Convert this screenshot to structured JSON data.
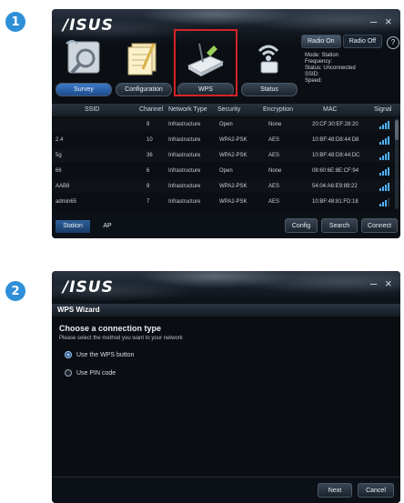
{
  "steps": [
    "1",
    "2"
  ],
  "window1": {
    "logo": "/ISUS",
    "controls": {
      "minimize": "–",
      "close": "×"
    },
    "nav": [
      {
        "label": "Survey",
        "icon": "survey-icon",
        "active": true
      },
      {
        "label": "Configuration",
        "icon": "configuration-icon",
        "active": false
      },
      {
        "label": "WPS",
        "icon": "wps-router-icon",
        "active": false
      },
      {
        "label": "Status",
        "icon": "status-signal-icon",
        "active": false
      }
    ],
    "radio": {
      "on_label": "Radio On",
      "off_label": "Radio Off"
    },
    "help": "?",
    "status_lines": [
      "Mode: Station",
      "Frequency:",
      "Status: Unconnected",
      "SSID:",
      "Speed:"
    ],
    "table": {
      "headers": [
        "SSID",
        "Channel",
        "Network Type",
        "Security",
        "Encryption",
        "MAC",
        "Signal"
      ],
      "rows": [
        {
          "ssid": "",
          "channel": "9",
          "type": "Infrastructure",
          "security": "Open",
          "encryption": "None",
          "mac": "20:CF:30:EF:28:20",
          "signal": 4
        },
        {
          "ssid": "2.4",
          "channel": "10",
          "type": "Infrastructure",
          "security": "WPA2-PSK",
          "encryption": "AES",
          "mac": "10:BF:48:D8:44:D8",
          "signal": 4
        },
        {
          "ssid": "5g",
          "channel": "36",
          "type": "Infrastructure",
          "security": "WPA2-PSK",
          "encryption": "AES",
          "mac": "10:BF:48:D8:44:DC",
          "signal": 4
        },
        {
          "ssid": "66",
          "channel": "6",
          "type": "Infrastructure",
          "security": "Open",
          "encryption": "None",
          "mac": "08:60:6E:8E:CF:94",
          "signal": 4
        },
        {
          "ssid": "AAB8",
          "channel": "9",
          "type": "Infrastructure",
          "security": "WPA2-PSK",
          "encryption": "AES",
          "mac": "54:04:A6:E9:89:22",
          "signal": 4
        },
        {
          "ssid": "admin65",
          "channel": "7",
          "type": "Infrastructure",
          "security": "WPA2-PSK",
          "encryption": "AES",
          "mac": "10:BF:48:81:FD:18",
          "signal": 3
        }
      ]
    },
    "tabs": [
      "Station",
      "AP"
    ],
    "buttons": {
      "config": "Config",
      "search": "Search",
      "connect": "Connect"
    }
  },
  "window2": {
    "logo": "/ISUS",
    "controls": {
      "minimize": "–",
      "close": "×"
    },
    "title": "WPS Wizard",
    "heading": "Choose a connection type",
    "instruction": "Please select the method you want to your network",
    "options": [
      {
        "label": "Use the WPS button",
        "selected": true
      },
      {
        "label": "Use PIN code",
        "selected": false
      }
    ],
    "buttons": {
      "next": "Next",
      "cancel": "Cancel"
    }
  },
  "colors": {
    "accent": "#2f8fd8",
    "highlight": "#d42424",
    "signal": "#4fb2ff"
  }
}
